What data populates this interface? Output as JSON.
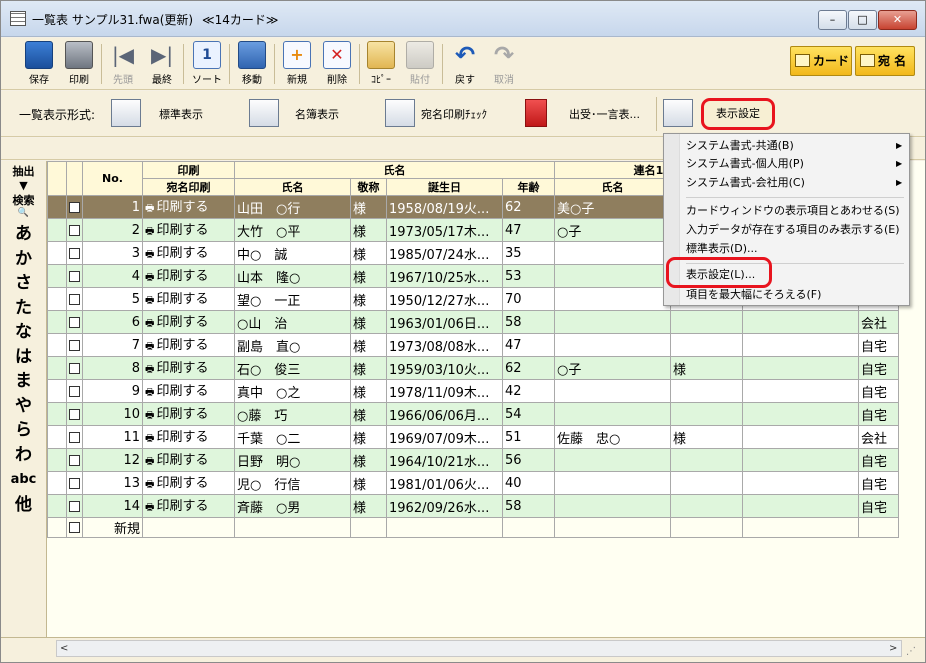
{
  "window": {
    "title": "一覧表 サンプル31.fwa(更新)",
    "card_count": "≪14カード≫",
    "min": "–",
    "max": "□",
    "close": "✕"
  },
  "toolbar": {
    "buttons": [
      {
        "label": "保存",
        "glyph": ""
      },
      {
        "label": "印刷",
        "glyph": ""
      },
      {
        "label": "先頭",
        "glyph": "|◀"
      },
      {
        "label": "最終",
        "glyph": "▶|"
      },
      {
        "label": "ソート",
        "glyph": "1"
      },
      {
        "label": "移動",
        "glyph": ""
      },
      {
        "label": "新規",
        "glyph": "+"
      },
      {
        "label": "削除",
        "glyph": "✕"
      },
      {
        "label": "ｺﾋﾟｰ",
        "glyph": ""
      },
      {
        "label": "貼付",
        "glyph": ""
      },
      {
        "label": "戻す",
        "glyph": "↶"
      },
      {
        "label": "取消",
        "glyph": "↷"
      }
    ],
    "card": "カード",
    "address": "宛 名"
  },
  "view": {
    "label": "一覧表示形式:",
    "standard": "標準表示",
    "roster": "名簿表示",
    "address_check": "宛名印刷ﾁｪｯｸ",
    "send_receive": "出受･一言表...",
    "display_settings": "表示設定"
  },
  "sidebar": {
    "extract": "抽出",
    "extract_icon": "▼",
    "search": "検索",
    "search_icon": "🔍",
    "kana": [
      "あ",
      "か",
      "さ",
      "た",
      "な",
      "は",
      "ま",
      "や",
      "ら",
      "わ"
    ],
    "abc": "abc",
    "other": "他"
  },
  "table": {
    "headers": {
      "no": "No.",
      "print_group": "印刷",
      "print_sub": "宛名印刷",
      "name_group": "氏名",
      "name": "氏名",
      "honorific": "敬称",
      "birth": "誕生日",
      "age": "年齢",
      "joint_group": "連名1",
      "joint_name": "氏名"
    },
    "print_icon": "🖶",
    "rows": [
      {
        "no": "1",
        "print": "印刷する",
        "name": "山田　○行",
        "hon": "様",
        "birth": "1958/08/19火...",
        "age": "62",
        "joint": "美○子",
        "jhon": "",
        "extra": ""
      },
      {
        "no": "2",
        "print": "印刷する",
        "name": "大竹　○平",
        "hon": "様",
        "birth": "1973/05/17木...",
        "age": "47",
        "joint": "○子",
        "jhon": "",
        "extra": ""
      },
      {
        "no": "3",
        "print": "印刷する",
        "name": "中○　誠",
        "hon": "様",
        "birth": "1985/07/24水...",
        "age": "35",
        "joint": "",
        "jhon": "",
        "extra": ""
      },
      {
        "no": "4",
        "print": "印刷する",
        "name": "山本　隆○",
        "hon": "様",
        "birth": "1967/10/25水...",
        "age": "53",
        "joint": "",
        "jhon": "",
        "extra": ""
      },
      {
        "no": "5",
        "print": "印刷する",
        "name": "望○　一正",
        "hon": "様",
        "birth": "1950/12/27水...",
        "age": "70",
        "joint": "",
        "jhon": "",
        "extra": ""
      },
      {
        "no": "6",
        "print": "印刷する",
        "name": "○山　治",
        "hon": "様",
        "birth": "1963/01/06日...",
        "age": "58",
        "joint": "",
        "jhon": "",
        "extra": "会社"
      },
      {
        "no": "7",
        "print": "印刷する",
        "name": "副島　直○",
        "hon": "様",
        "birth": "1973/08/08水...",
        "age": "47",
        "joint": "",
        "jhon": "",
        "extra": "自宅"
      },
      {
        "no": "8",
        "print": "印刷する",
        "name": "石○　俊三",
        "hon": "様",
        "birth": "1959/03/10火...",
        "age": "62",
        "joint": "○子",
        "jhon": "様",
        "extra": "自宅"
      },
      {
        "no": "9",
        "print": "印刷する",
        "name": "真中　○之",
        "hon": "様",
        "birth": "1978/11/09木...",
        "age": "42",
        "joint": "",
        "jhon": "",
        "extra": "自宅"
      },
      {
        "no": "10",
        "print": "印刷する",
        "name": "○藤　巧",
        "hon": "様",
        "birth": "1966/06/06月...",
        "age": "54",
        "joint": "",
        "jhon": "",
        "extra": "自宅"
      },
      {
        "no": "11",
        "print": "印刷する",
        "name": "千葉　○二",
        "hon": "様",
        "birth": "1969/07/09木...",
        "age": "51",
        "joint": "佐藤　忠○",
        "jhon": "様",
        "extra": "会社"
      },
      {
        "no": "12",
        "print": "印刷する",
        "name": "日野　明○",
        "hon": "様",
        "birth": "1964/10/21水...",
        "age": "56",
        "joint": "",
        "jhon": "",
        "extra": "自宅"
      },
      {
        "no": "13",
        "print": "印刷する",
        "name": "児○　行信",
        "hon": "様",
        "birth": "1981/01/06火...",
        "age": "40",
        "joint": "",
        "jhon": "",
        "extra": "自宅"
      },
      {
        "no": "14",
        "print": "印刷する",
        "name": "斉藤　○男",
        "hon": "様",
        "birth": "1962/09/26水...",
        "age": "58",
        "joint": "",
        "jhon": "",
        "extra": "自宅"
      }
    ],
    "new_row": "新規"
  },
  "menu": {
    "items": [
      {
        "label": "システム書式-共通(B)",
        "arrow": "▶"
      },
      {
        "label": "システム書式-個人用(P)",
        "arrow": "▶"
      },
      {
        "label": "システム書式-会社用(C)",
        "arrow": "▶"
      },
      {
        "label": "カードウィンドウの表示項目とあわせる(S)",
        "arrow": ""
      },
      {
        "label": "入力データが存在する項目のみ表示する(E)",
        "arrow": ""
      },
      {
        "label": "標準表示(D)...",
        "arrow": ""
      },
      {
        "label": "表示設定(L)...",
        "arrow": ""
      },
      {
        "label": "項目を最大幅にそろえる(F)",
        "arrow": ""
      }
    ]
  },
  "statusbar": {
    "left_arrow": "<",
    "right_arrow": ">",
    "grip": "⋰"
  }
}
